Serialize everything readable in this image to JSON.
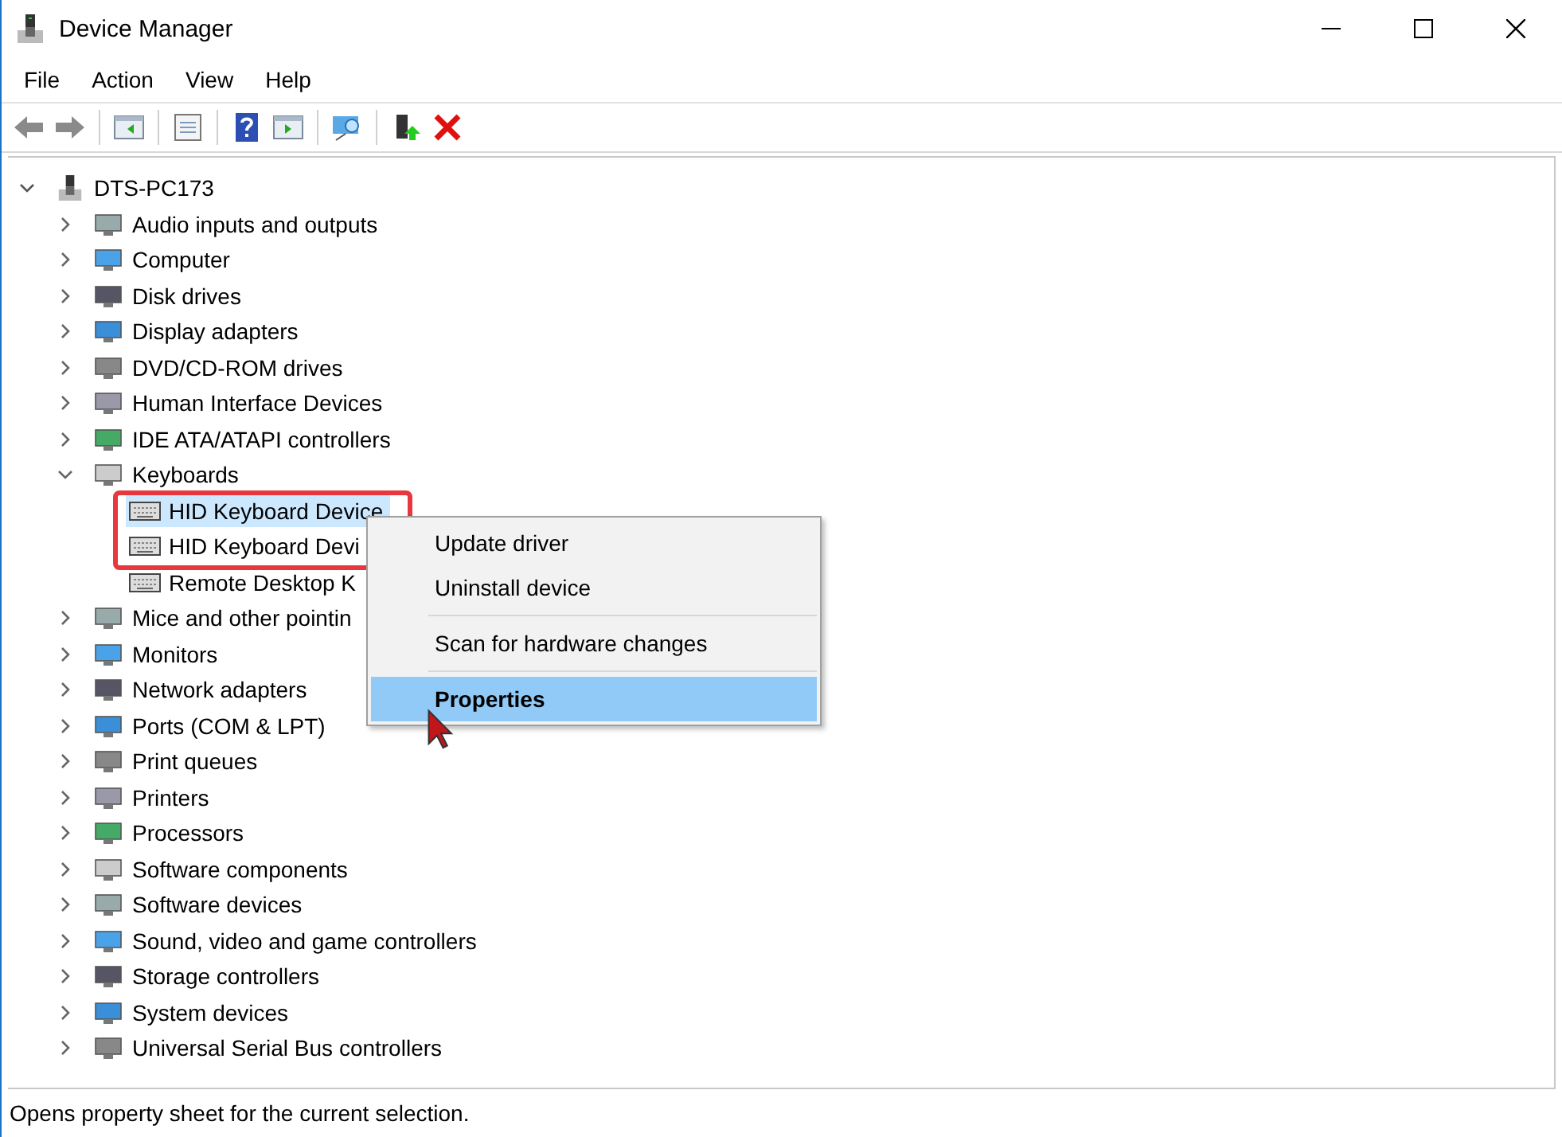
{
  "window": {
    "title": "Device Manager"
  },
  "menu_bar": [
    "File",
    "Action",
    "View",
    "Help"
  ],
  "tree": {
    "label": "DTS-PC173",
    "expanded": true,
    "children": [
      {
        "label": "Audio inputs and outputs",
        "expanded": false
      },
      {
        "label": "Computer",
        "expanded": false
      },
      {
        "label": "Disk drives",
        "expanded": false
      },
      {
        "label": "Display adapters",
        "expanded": false
      },
      {
        "label": "DVD/CD-ROM drives",
        "expanded": false
      },
      {
        "label": "Human Interface Devices",
        "expanded": false
      },
      {
        "label": "IDE ATA/ATAPI controllers",
        "expanded": false
      },
      {
        "label": "Keyboards",
        "expanded": true,
        "children": [
          {
            "label": "HID Keyboard Device",
            "selected": true
          },
          {
            "label": "HID Keyboard Devi",
            "selected": false
          },
          {
            "label": "Remote Desktop K",
            "selected": false
          }
        ]
      },
      {
        "label": "Mice and other pointin",
        "expanded": false
      },
      {
        "label": "Monitors",
        "expanded": false
      },
      {
        "label": "Network adapters",
        "expanded": false
      },
      {
        "label": "Ports (COM & LPT)",
        "expanded": false
      },
      {
        "label": "Print queues",
        "expanded": false
      },
      {
        "label": "Printers",
        "expanded": false
      },
      {
        "label": "Processors",
        "expanded": false
      },
      {
        "label": "Software components",
        "expanded": false
      },
      {
        "label": "Software devices",
        "expanded": false
      },
      {
        "label": "Sound, video and game controllers",
        "expanded": false
      },
      {
        "label": "Storage controllers",
        "expanded": false
      },
      {
        "label": "System devices",
        "expanded": false
      },
      {
        "label": "Universal Serial Bus controllers",
        "expanded": false
      }
    ]
  },
  "context_menu": [
    {
      "kind": "item",
      "label": "Update driver",
      "selected": false,
      "default": false
    },
    {
      "kind": "item",
      "label": "Uninstall device",
      "selected": false,
      "default": false
    },
    {
      "kind": "separator"
    },
    {
      "kind": "item",
      "label": "Scan for hardware changes",
      "selected": false,
      "default": false
    },
    {
      "kind": "separator"
    },
    {
      "kind": "item",
      "label": "Properties",
      "selected": true,
      "default": true
    }
  ],
  "status_bar": "Opens property sheet for the current selection."
}
